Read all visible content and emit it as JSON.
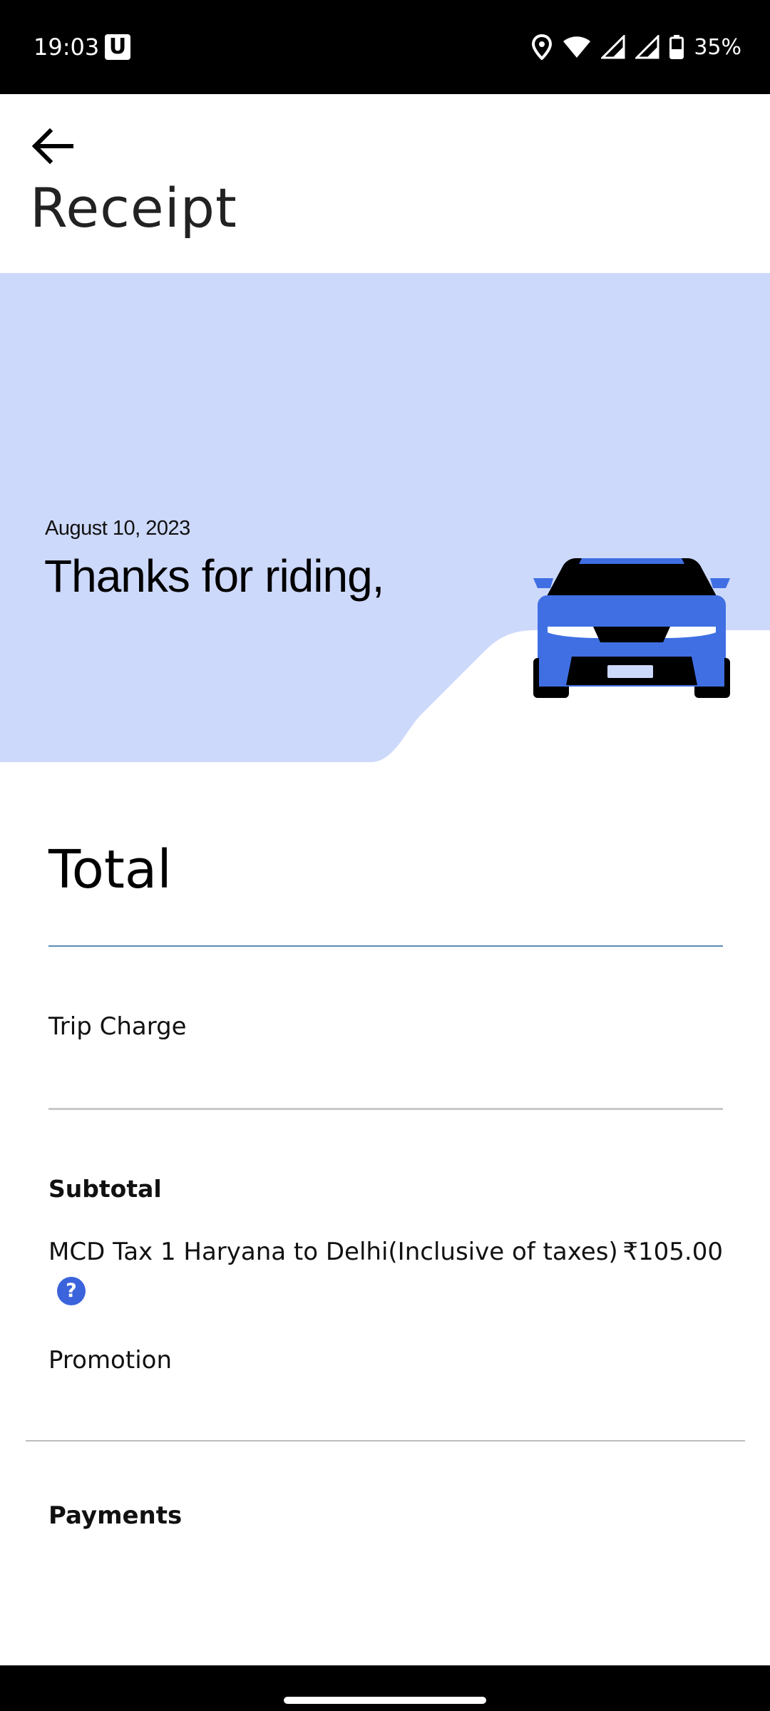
{
  "status_bar": {
    "time": "19:03",
    "app_badge": "U",
    "battery": "35%",
    "icons": [
      "location-icon",
      "wifi-icon",
      "signal-icon",
      "signal-icon",
      "battery-icon"
    ]
  },
  "header": {
    "back_icon": "arrow-left-icon",
    "title": "Receipt"
  },
  "hero": {
    "date": "August 10, 2023",
    "greeting": "Thanks for riding,",
    "background_color": "#cdd9fb",
    "car_color": "#3f6fe3"
  },
  "receipt": {
    "total_label": "Total",
    "trip_charge_label": "Trip Charge",
    "subtotal_label": "Subtotal",
    "tax_line": {
      "label": "MCD Tax 1 Haryana to Delhi(Inclusive of taxes)",
      "amount": "₹105.00",
      "help_icon": "?"
    },
    "promotion_label": "Promotion",
    "payments_label": "Payments"
  },
  "colors": {
    "accent": "#3b63db",
    "divider_blue": "#5b8bb5"
  }
}
